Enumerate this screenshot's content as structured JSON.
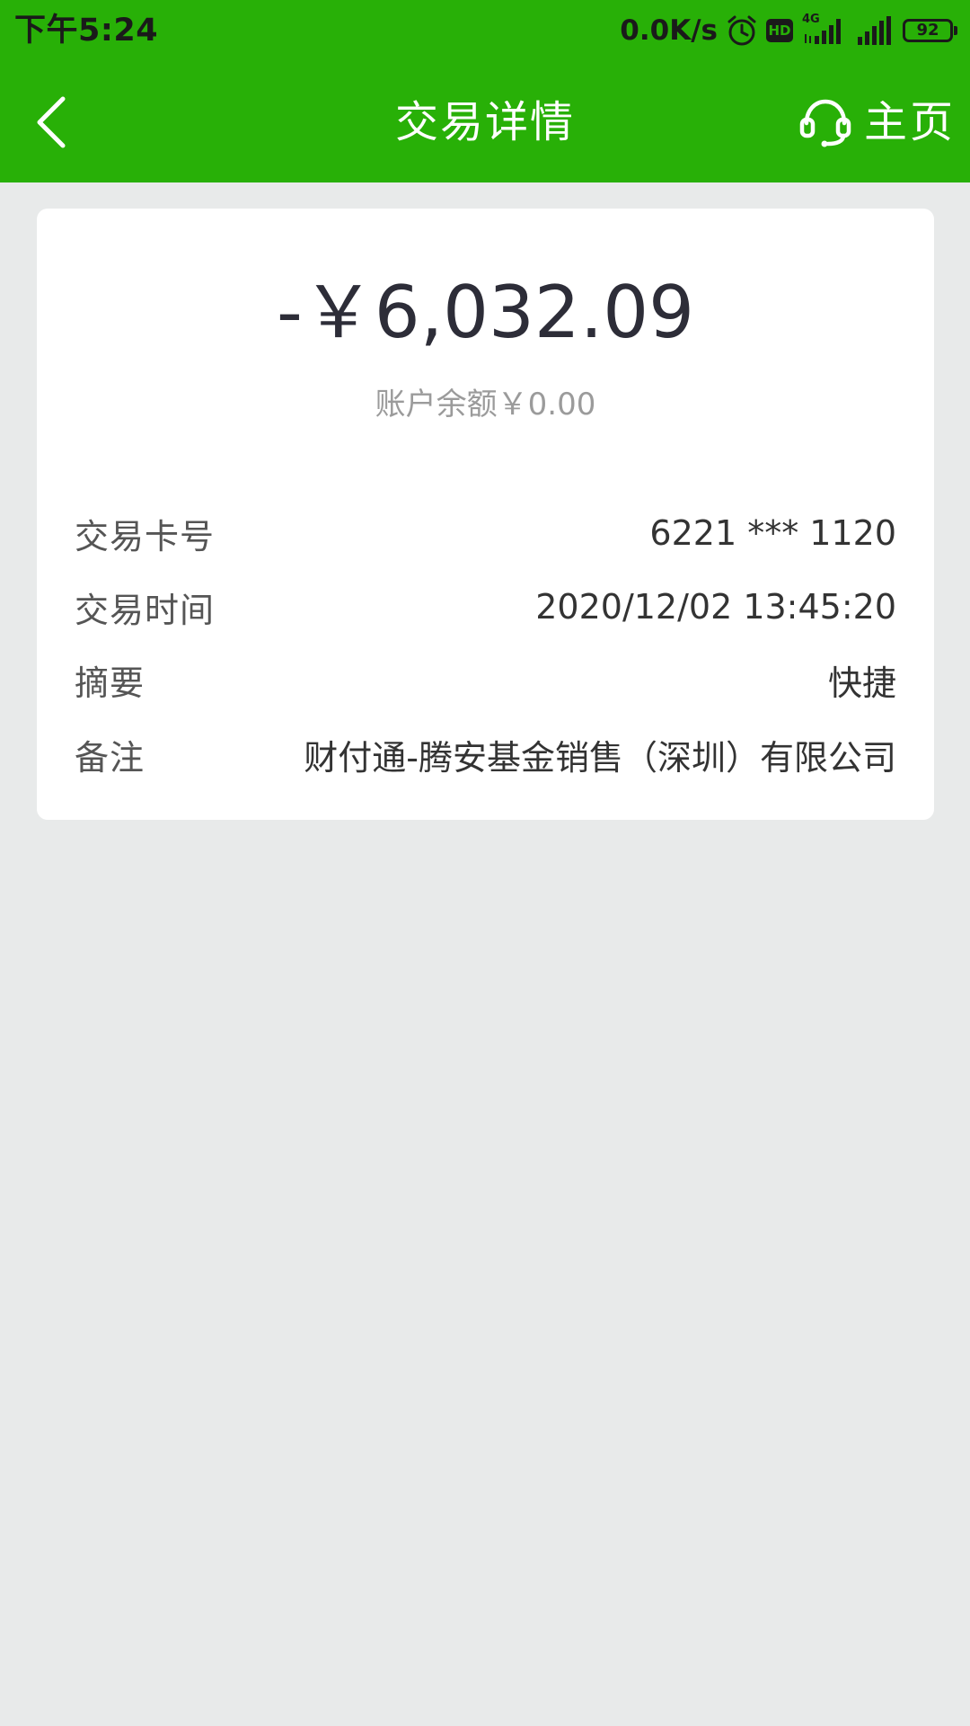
{
  "status_bar": {
    "time": "下午5:24",
    "net_speed": "0.0K/s",
    "network_type": "4G",
    "hd_badge": "HD",
    "battery_level": "92",
    "icons": [
      "alarm-icon",
      "hd-icon",
      "signal-4g-icon",
      "signal-icon",
      "battery-icon"
    ]
  },
  "nav": {
    "title": "交易详情",
    "home_label": "主页",
    "back_icon": "chevron-left-icon",
    "service_icon": "headset-icon"
  },
  "transaction": {
    "amount": "-￥6,032.09",
    "balance": "账户余额￥0.00",
    "details": [
      {
        "label": "交易卡号",
        "value": "6221 *** 1120"
      },
      {
        "label": "交易时间",
        "value": "2020/12/02 13:45:20"
      },
      {
        "label": "摘要",
        "value": "快捷"
      },
      {
        "label": "备注",
        "value": "财付通-腾安基金销售（深圳）有限公司"
      }
    ]
  },
  "colors": {
    "header_green": "#28b007",
    "background": "#e8eaea",
    "card": "#ffffff",
    "amount_text": "#2d2d38",
    "muted_text": "#9b9b9b"
  }
}
